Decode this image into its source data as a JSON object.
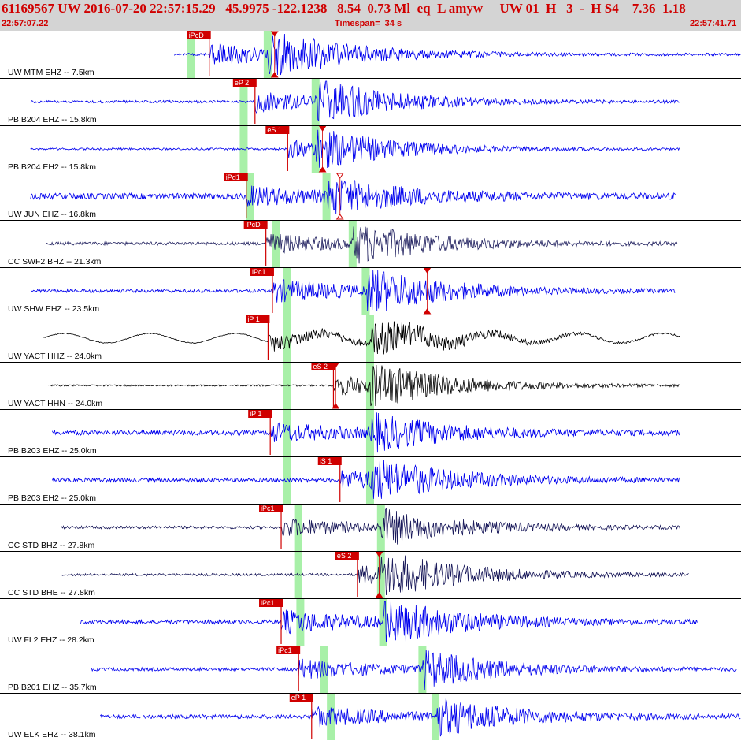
{
  "header": {
    "title": "61169567 UW 2016-07-20 22:57:15.29   45.9975 -122.1238   8.54  0.73 Ml  eq  L amyw     UW 01  H   3  -  H S4    7.36  1.18",
    "start_time": "22:57:07.22",
    "timespan": "Timespan=  34 s",
    "end_time": "22:57:41.71"
  },
  "colors": {
    "blue": "#0000ee",
    "navy": "#1c1c5c",
    "black": "#000000",
    "pick": "#d00000",
    "window": "#a8f0a8"
  },
  "chart_data": {
    "type": "line",
    "title": "61169567 UW 2016-07-20 22:57:15.29",
    "x_start": "22:57:07.22",
    "x_end": "22:57:41.71",
    "timespan_s": 34,
    "traces": [
      {
        "label": "UW MTM EHZ -- 7.5km",
        "color": "blue",
        "start": 8,
        "end": 34,
        "noise": 0.06,
        "amp": 1.0,
        "p_win": 8.6,
        "s_win": 12.1,
        "pick": {
          "text": "iPcD",
          "t": 9.6
        },
        "arrival": {
          "t": 12.6,
          "hollow": false
        }
      },
      {
        "label": "PB B204 EHZ -- 15.8km",
        "color": "blue",
        "start": 1.4,
        "end": 31.2,
        "noise": 0.06,
        "amp": 0.9,
        "p_win": 11.0,
        "s_win": 14.3,
        "pick": {
          "text": "eP 2",
          "t": 11.7
        },
        "arrival": null
      },
      {
        "label": "PB B204 EH2 -- 15.8km",
        "color": "blue",
        "start": 1.4,
        "end": 31.2,
        "noise": 0.05,
        "amp": 0.75,
        "p_win": 11.0,
        "s_win": 14.3,
        "pick": {
          "text": "eS 1",
          "t": 13.2
        },
        "arrival": {
          "t": 14.8,
          "hollow": false
        }
      },
      {
        "label": "UW JUN EHZ -- 16.8km",
        "color": "blue",
        "start": 1.4,
        "end": 31.0,
        "noise": 0.15,
        "amp": 0.75,
        "p_win": 11.3,
        "s_win": 14.8,
        "pick": {
          "text": "iPd1",
          "t": 11.3
        },
        "arrival": {
          "t": 15.6,
          "hollow": true
        }
      },
      {
        "label": "CC SWF2 BHZ -- 21.3km",
        "color": "navy",
        "start": 2.1,
        "end": 31.1,
        "noise": 0.08,
        "amp": 0.85,
        "p_win": 12.5,
        "s_win": 16.0,
        "pick": {
          "text": "iPcD",
          "t": 12.2
        },
        "arrival": null
      },
      {
        "label": "UW SHW EHZ -- 23.5km",
        "color": "blue",
        "start": 1.4,
        "end": 31.0,
        "noise": 0.08,
        "amp": 1.0,
        "p_win": 13.0,
        "s_win": 16.6,
        "pick": {
          "text": "iPc1",
          "t": 12.5
        },
        "arrival": {
          "t": 19.6,
          "hollow": false
        }
      },
      {
        "label": "UW YACT HHZ -- 24.0km",
        "color": "black",
        "start": 2.0,
        "end": 31.2,
        "noise": 0.02,
        "amp": 0.8,
        "p_win": 13.0,
        "s_win": 16.8,
        "pick": {
          "text": "iP 1",
          "t": 12.3
        },
        "arrival": null
      },
      {
        "label": "UW YACT HHN -- 24.0km",
        "color": "black",
        "start": 2.2,
        "end": 31.2,
        "noise": 0.04,
        "amp": 0.9,
        "p_win": 13.0,
        "s_win": 16.8,
        "pick": {
          "text": "eS 2",
          "t": 15.3
        },
        "arrival": {
          "t": 15.4,
          "hollow": false
        }
      },
      {
        "label": "PB B203 EHZ -- 25.0km",
        "color": "blue",
        "start": 2.4,
        "end": 31.2,
        "noise": 0.12,
        "amp": 0.8,
        "p_win": 13.0,
        "s_win": 16.8,
        "pick": {
          "text": "iP 1",
          "t": 12.4
        },
        "arrival": null
      },
      {
        "label": "PB B203 EH2 -- 25.0km",
        "color": "blue",
        "start": 2.4,
        "end": 31.2,
        "noise": 0.1,
        "amp": 0.8,
        "p_win": 13.0,
        "s_win": 16.8,
        "pick": {
          "text": "iS 1",
          "t": 15.6
        },
        "arrival": null
      },
      {
        "label": "CC STD BHZ -- 27.8km",
        "color": "navy",
        "start": 2.8,
        "end": 31.2,
        "noise": 0.07,
        "amp": 0.8,
        "p_win": 13.5,
        "s_win": 17.3,
        "pick": {
          "text": "iPc1",
          "t": 12.9
        },
        "arrival": null
      },
      {
        "label": "CC STD BHE -- 27.8km",
        "color": "navy",
        "start": 2.8,
        "end": 31.6,
        "noise": 0.06,
        "amp": 0.85,
        "p_win": 13.5,
        "s_win": 17.3,
        "pick": {
          "text": "eS 2",
          "t": 16.4
        },
        "arrival": {
          "t": 17.4,
          "hollow": false
        }
      },
      {
        "label": "UW FL2 EHZ -- 28.2km",
        "color": "blue",
        "start": 3.7,
        "end": 32.0,
        "noise": 0.1,
        "amp": 1.0,
        "p_win": 13.6,
        "s_win": 17.4,
        "pick": {
          "text": "iPc1",
          "t": 12.9
        },
        "arrival": null
      },
      {
        "label": "PB B201 EHZ -- 35.7km",
        "color": "blue",
        "start": 4.2,
        "end": 33.8,
        "noise": 0.08,
        "amp": 0.85,
        "p_win": 14.7,
        "s_win": 19.2,
        "pick": {
          "text": "iPc1",
          "t": 13.7
        },
        "arrival": null
      },
      {
        "label": "UW ELK EHZ -- 38.1km",
        "color": "blue",
        "start": 4.6,
        "end": 34.0,
        "noise": 0.1,
        "amp": 0.85,
        "p_win": 15.0,
        "s_win": 19.8,
        "pick": {
          "text": "eP 1",
          "t": 14.3
        },
        "arrival": null
      }
    ]
  }
}
